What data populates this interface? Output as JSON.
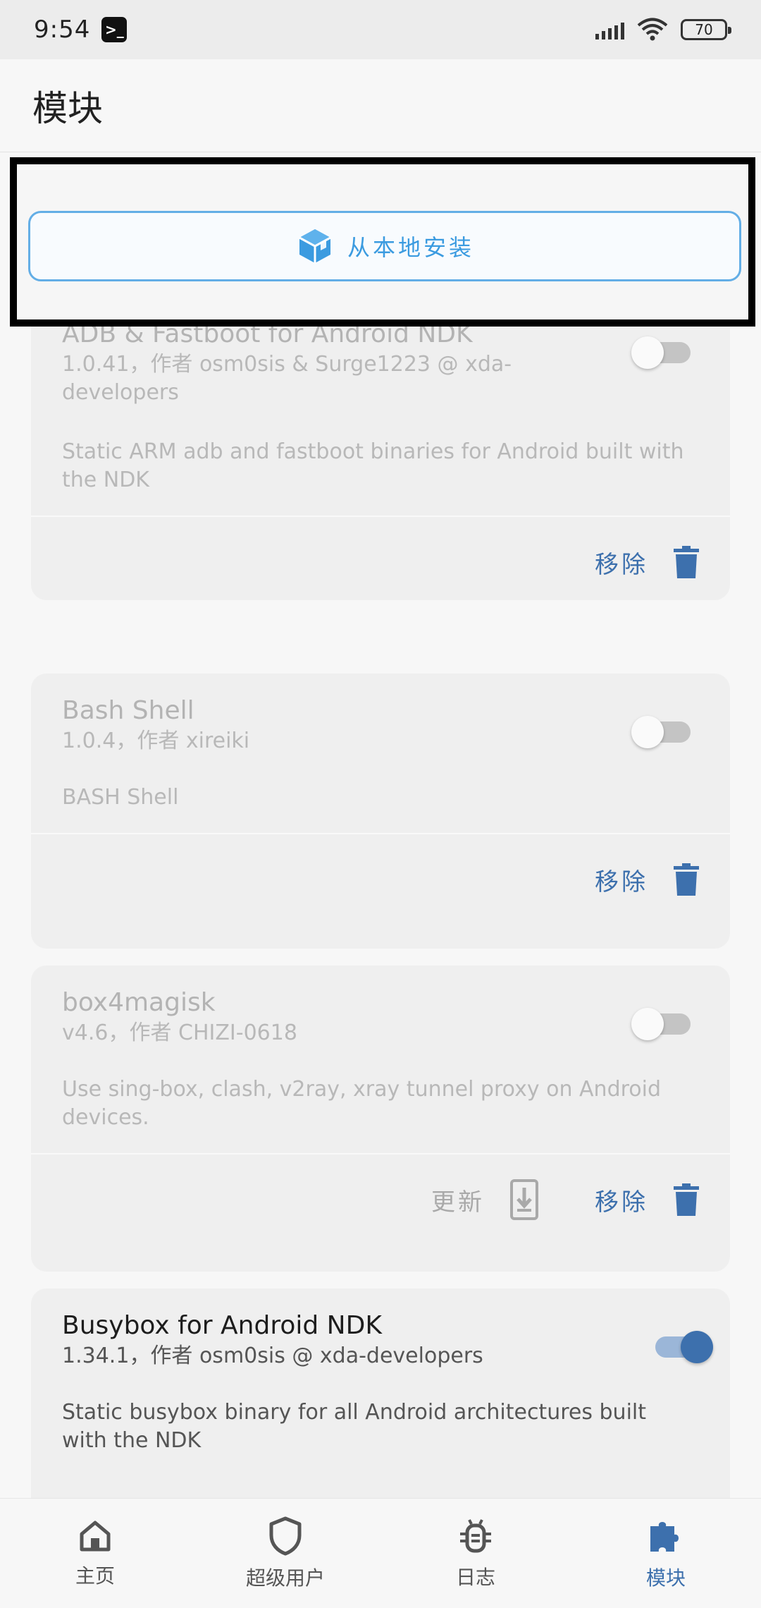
{
  "status_bar": {
    "time": "9:54",
    "app_icon_glyph": ">_",
    "battery": "70"
  },
  "app_bar": {
    "title": "模块"
  },
  "install": {
    "label": "从本地安装",
    "accent": "#3b9be0"
  },
  "modules": [
    {
      "title": "ADB & Fastboot for Android NDK",
      "meta": "1.0.41，作者 osm0sis & Surge1223 @ xda-developers",
      "description": "Static ARM adb and fastboot binaries for Android built with the NDK",
      "enabled": false,
      "actions": {
        "remove": "移除"
      }
    },
    {
      "title": "Bash Shell",
      "meta": "1.0.4，作者 xireiki",
      "description": "BASH Shell",
      "enabled": false,
      "actions": {
        "remove": "移除"
      }
    },
    {
      "title": "box4magisk",
      "meta": "v4.6，作者 CHIZI-0618",
      "description": "Use sing-box, clash, v2ray, xray tunnel proxy on Android devices.",
      "enabled": false,
      "actions": {
        "update": "更新",
        "remove": "移除"
      }
    },
    {
      "title": "Busybox for Android NDK",
      "meta": "1.34.1，作者 osm0sis @ xda-developers",
      "description": "Static busybox binary for all Android architectures built with the NDK",
      "enabled": true
    }
  ],
  "bottom_nav": {
    "items": [
      {
        "label": "主页",
        "icon": "home-icon"
      },
      {
        "label": "超级用户",
        "icon": "shield-icon"
      },
      {
        "label": "日志",
        "icon": "bug-icon"
      },
      {
        "label": "模块",
        "icon": "puzzle-icon"
      }
    ],
    "active_index": 3,
    "active_color": "#3d70ad"
  }
}
